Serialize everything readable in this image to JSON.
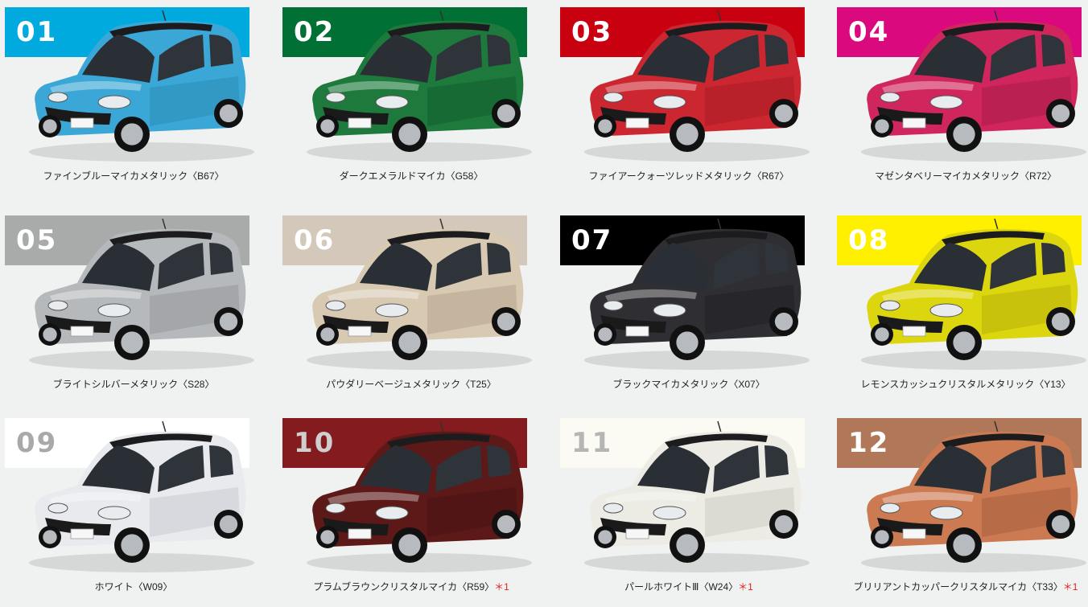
{
  "colors": [
    {
      "num": "01",
      "name": "ファインブルーマイカメタリック〈B67〉",
      "band": "#00aadf",
      "body": "#3aa7d6",
      "dark": "#1d6f93",
      "numColor": "#ffffff",
      "mark": ""
    },
    {
      "num": "02",
      "name": "ダークエメラルドマイカ〈G58〉",
      "band": "#007034",
      "body": "#1d7a3c",
      "dark": "#0b3d1d",
      "numColor": "#ffffff",
      "mark": ""
    },
    {
      "num": "03",
      "name": "ファイアークォーツレッドメタリック〈R67〉",
      "band": "#c8000f",
      "body": "#cc2630",
      "dark": "#7a1016",
      "numColor": "#ffffff",
      "mark": ""
    },
    {
      "num": "04",
      "name": "マゼンタベリーマイカメタリック〈R72〉",
      "band": "#da0a7e",
      "body": "#d0265d",
      "dark": "#7c0f33",
      "numColor": "#ffffff",
      "mark": ""
    },
    {
      "num": "05",
      "name": "ブライトシルバーメタリック〈S28〉",
      "band": "#a9abaa",
      "body": "#b6b9bb",
      "dark": "#6e7174",
      "numColor": "#ffffff",
      "mark": ""
    },
    {
      "num": "06",
      "name": "パウダリーベージュメタリック〈T25〉",
      "band": "#d4c8bb",
      "body": "#d8c9b2",
      "dark": "#8d7d67",
      "numColor": "#ffffff",
      "mark": ""
    },
    {
      "num": "07",
      "name": "ブラックマイカメタリック〈X07〉",
      "band": "#000000",
      "body": "#2f2f33",
      "dark": "#111114",
      "numColor": "#ffffff",
      "mark": ""
    },
    {
      "num": "08",
      "name": "レモンスカッシュクリスタルメタリック〈Y13〉",
      "band": "#fff000",
      "body": "#dcd60e",
      "dark": "#8a8608",
      "numColor": "#ffffff",
      "mark": ""
    },
    {
      "num": "09",
      "name": "ホワイト〈W09〉",
      "band": "#ffffff",
      "body": "#e8eaee",
      "dark": "#a6a9ae",
      "numColor": "#a9a9a9",
      "mark": ""
    },
    {
      "num": "10",
      "name": "プラムブラウンクリスタルマイカ〈R59〉",
      "band": "#841b1e",
      "body": "#5d1818",
      "dark": "#2e0a0a",
      "numColor": "#cfcfcf",
      "mark": "＊1"
    },
    {
      "num": "11",
      "name": "パールホワイトⅢ〈W24〉",
      "band": "#fbfbf3",
      "body": "#ecebe4",
      "dark": "#a9a79e",
      "numColor": "#b5b5b5",
      "mark": "＊1"
    },
    {
      "num": "12",
      "name": "ブリリアントカッパークリスタルマイカ〈T33〉",
      "band": "#b07859",
      "body": "#cc7a52",
      "dark": "#7b4028",
      "numColor": "#ffffff",
      "mark": "＊1"
    }
  ]
}
